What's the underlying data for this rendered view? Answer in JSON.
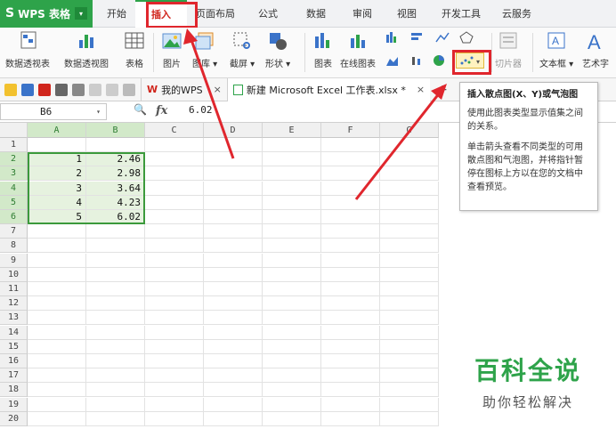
{
  "app": {
    "logo_text": "WPS 表格",
    "logo_mark": "S",
    "logo_dd": "▾"
  },
  "menu": {
    "tabs": [
      "开始",
      "插入",
      "页面布局",
      "公式",
      "数据",
      "审阅",
      "视图",
      "开发工具",
      "云服务"
    ],
    "active_tab": "插入"
  },
  "ribbon": {
    "buttons": [
      {
        "label": "数据透视表",
        "icon": "pivot-table-icon"
      },
      {
        "label": "数据透视图",
        "icon": "pivot-chart-icon"
      },
      {
        "label": "表格",
        "icon": "table-icon"
      },
      {
        "label": "图片",
        "icon": "picture-icon"
      },
      {
        "label": "图库 ▾",
        "icon": "gallery-icon"
      },
      {
        "label": "截屏 ▾",
        "icon": "screenshot-icon"
      },
      {
        "label": "形状 ▾",
        "icon": "shape-icon"
      },
      {
        "label": "图表",
        "icon": "chart-icon"
      },
      {
        "label": "在线图表",
        "icon": "online-chart-icon"
      },
      {
        "label": "切片器",
        "icon": "slicer-icon"
      },
      {
        "label": "文本框 ▾",
        "icon": "textbox-icon"
      },
      {
        "label": "艺术字",
        "icon": "wordart-icon"
      }
    ]
  },
  "quickbar": {
    "doc_tabs": [
      {
        "label": "我的WPS",
        "close": "×"
      },
      {
        "label": "新建 Microsoft Excel 工作表.xlsx *",
        "close": "×"
      }
    ],
    "add": "+"
  },
  "formula_bar": {
    "cell_ref": "B6",
    "fx": "fx",
    "value": "6.02"
  },
  "grid": {
    "columns": [
      "A",
      "B",
      "C",
      "D",
      "E",
      "F",
      "G"
    ],
    "rows": [
      "1",
      "2",
      "3",
      "4",
      "5",
      "6",
      "7",
      "8",
      "9",
      "10",
      "11",
      "12",
      "13",
      "14",
      "15",
      "16",
      "17",
      "18",
      "19",
      "20"
    ],
    "data": [
      {
        "row": 2,
        "a": "1",
        "b": "2.46"
      },
      {
        "row": 3,
        "a": "2",
        "b": "2.98"
      },
      {
        "row": 4,
        "a": "3",
        "b": "3.64"
      },
      {
        "row": 5,
        "a": "4",
        "b": "4.23"
      },
      {
        "row": 6,
        "a": "5",
        "b": "6.02"
      }
    ]
  },
  "tooltip": {
    "title": "插入散点图(X、Y)或气泡图",
    "p1": "使用此图表类型显示值集之间的关系。",
    "p2": "单击箭头查看不同类型的可用散点图和气泡图，并将指针暂停在图标上方以在您的文档中查看预览。"
  },
  "watermark": {
    "title": "百科全说",
    "subtitle": "助你轻松解决"
  },
  "colors": {
    "accent": "#2ea34a",
    "highlight": "#e0262d",
    "selection": "#3b9a3b"
  }
}
